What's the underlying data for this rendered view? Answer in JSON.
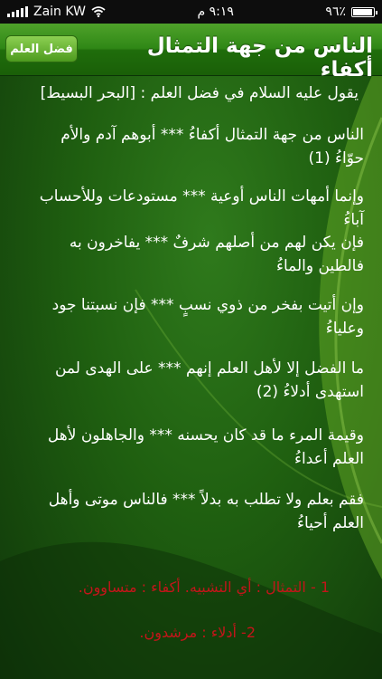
{
  "status_bar": {
    "carrier": "Zain KW",
    "time": "٩:١٩ م",
    "battery": "٪٩٦",
    "battery_level": 0.96
  },
  "nav": {
    "title": "الناس من جهة التمثال أكفاء",
    "back_label": "فضل العلم"
  },
  "content": {
    "intro": "يقول عليه السلام في فضل العلم : [البحر البسيط]",
    "verses": [
      "الناس من جهة التمثال أكفاءُ *** أبوهم آدم والأم حوّاءُ (1)",
      "وإنما أمهات الناس أوعية *** مستودعات وللأحساب آباءُ",
      "فإن يكن لهم من أصلهم شرفٌ *** يفاخرون به فالطين والماءُ",
      "وإن أتيت بفخر من ذوي نسبٍ *** فإن نسبتنا جود وعلياءُ",
      "ما الفضل إلا لأهل العلم إنهم *** على الهدى لمن استهدى أدلاءُ (2)",
      "وقيمة المرء ما قد كان يحسنه *** والجاهلون لأهل العلم أعداءُ",
      "فقم بعلم ولا تطلب به بدلاً *** فالناس موتى وأهل العلم أحياءُ"
    ],
    "notes": [
      "1 - التمثال : أي التشبيه. أكفاء : متساوون.",
      "2- أدلاء : مرشدون."
    ]
  },
  "colors": {
    "background": "#1f5f10",
    "nav": "#2f8716",
    "note": "#c3151a"
  }
}
